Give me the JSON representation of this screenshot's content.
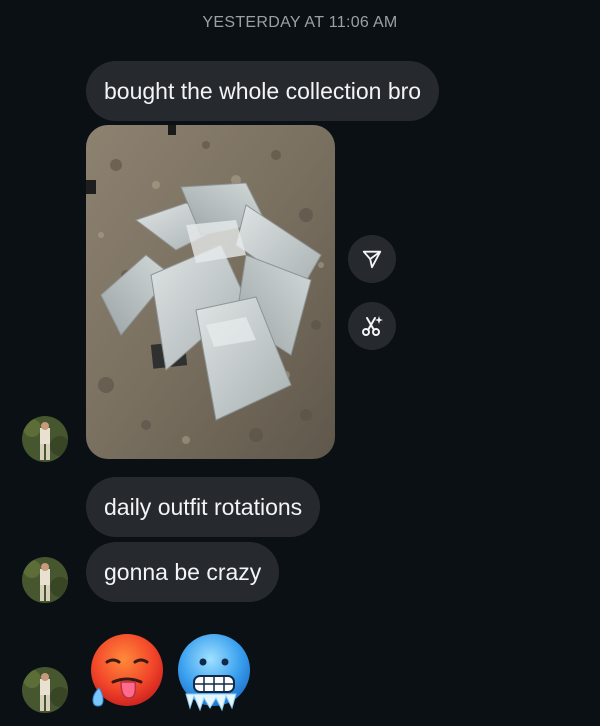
{
  "thread": {
    "timestamp": "YESTERDAY AT 11:06 AM"
  },
  "messages": [
    {
      "type": "text",
      "text": "bought the whole collection bro"
    },
    {
      "type": "image",
      "icon": "photo-of-grey-mailer-bags-on-floor"
    },
    {
      "type": "text",
      "text": "daily outfit rotations"
    },
    {
      "type": "text",
      "text": "gonna be crazy"
    },
    {
      "type": "emoji",
      "icons": [
        "hot-face-emoji",
        "cold-face-emoji"
      ]
    }
  ],
  "actions": {
    "share_icon": "share-icon",
    "ai_icon": "ai-sparkle-scissors-icon"
  },
  "colors": {
    "background": "#0b1014",
    "bubble": "#262a2f",
    "text": "#f2f4f5",
    "timestamp": "#99a1a7"
  }
}
